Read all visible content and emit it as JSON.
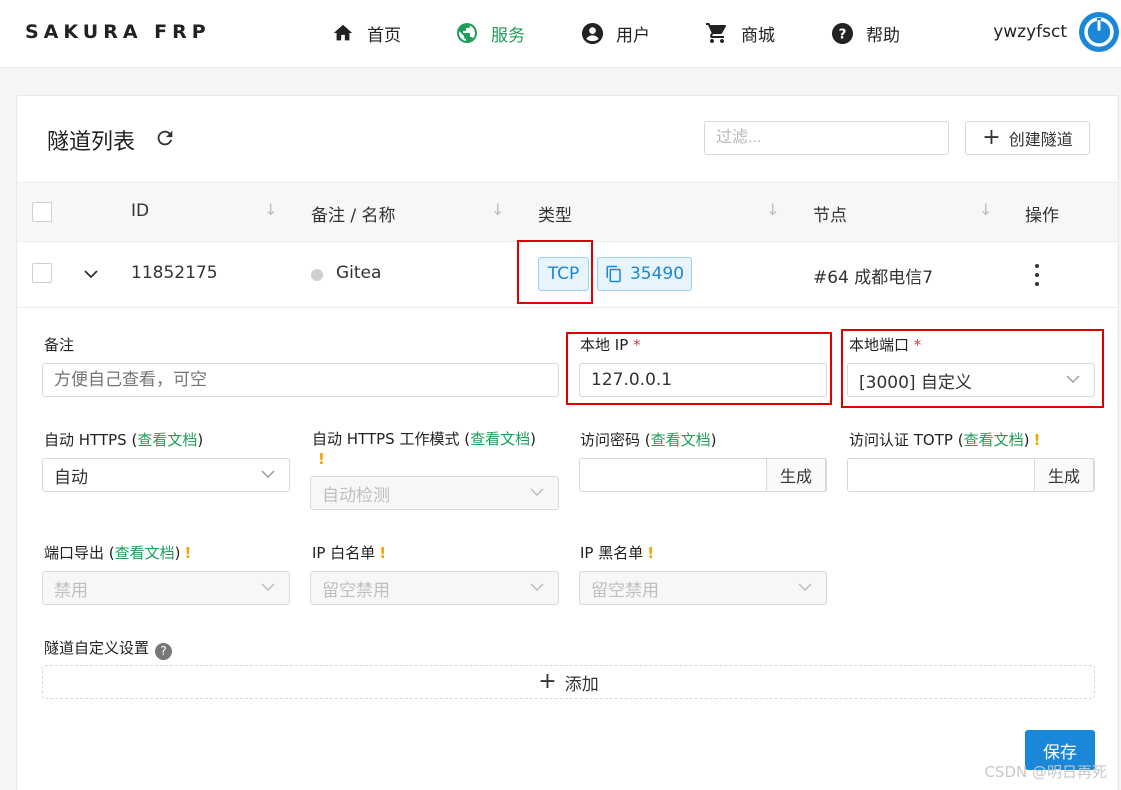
{
  "header": {
    "brand": "SAKURA FRP",
    "nav": [
      {
        "label": "首页",
        "icon": "home-icon"
      },
      {
        "label": "服务",
        "icon": "globe-icon",
        "active": true
      },
      {
        "label": "用户",
        "icon": "user-circle-icon"
      },
      {
        "label": "商城",
        "icon": "cart-icon"
      },
      {
        "label": "帮助",
        "icon": "help-circle-icon"
      }
    ],
    "username": "ywzyfsct",
    "accent_color": "#1e9e57",
    "avatar_color": "#1a87d8"
  },
  "list": {
    "title": "隧道列表",
    "filter_placeholder": "过滤...",
    "create_label": "创建隧道",
    "columns": [
      "ID",
      "备注 / 名称",
      "类型",
      "节点",
      "操作"
    ],
    "rows": [
      {
        "id": "11852175",
        "name": "Gitea",
        "type": "TCP",
        "remote_port": "35490",
        "node": "#64 成都电信7"
      }
    ]
  },
  "form": {
    "note_label": "备注",
    "note_placeholder": "方便自己查看，可空",
    "local_ip_label": "本地 IP",
    "local_ip_value": "127.0.0.1",
    "local_port_label": "本地端口",
    "local_port_value": "[3000] 自定义",
    "required_mark": "*",
    "doc_link": "查看文档",
    "auto_https_label": "自动 HTTPS",
    "auto_https_value": "自动",
    "https_mode_label": "自动 HTTPS 工作模式",
    "https_mode_value": "自动检测",
    "access_pw_label": "访问密码",
    "totp_label": "访问认证 TOTP",
    "generate_label": "生成",
    "port_export_label": "端口导出",
    "port_export_value": "禁用",
    "ip_white_label": "IP 白名单",
    "ip_white_value": "留空禁用",
    "ip_black_label": "IP 黑名单",
    "ip_black_value": "留空禁用",
    "custom_label": "隧道自定义设置",
    "add_label": "添加",
    "save_label": "保存",
    "warn_mark": "!"
  },
  "watermark": "CSDN @明日再死"
}
